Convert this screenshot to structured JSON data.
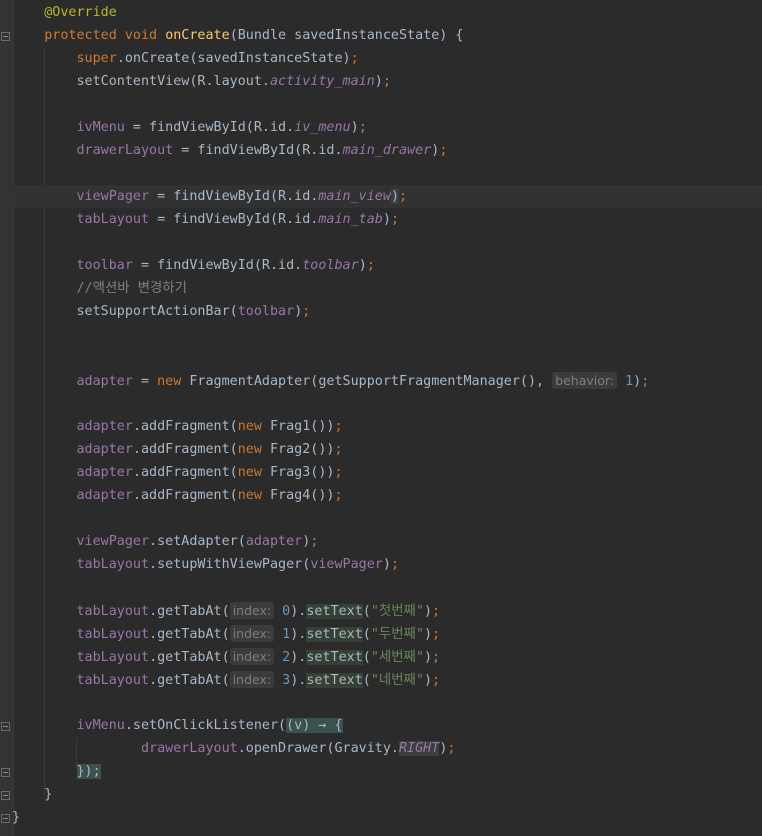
{
  "code": {
    "l1": {
      "annotation": "@Override"
    },
    "l2": {
      "kw": "protected void ",
      "fn": "onCreate",
      "rest": "(Bundle savedInstanceState) {"
    },
    "l3": {
      "kw": "super",
      "rest": ".onCreate(savedInstanceState)",
      "semi": ";"
    },
    "l4": {
      "pre": "setContentView(R.layout.",
      "field": "activity_main",
      "post": ")",
      "semi": ";"
    },
    "l5": {
      "var": "ivMenu",
      "pre": " = findViewById(R.id.",
      "field": "iv_menu",
      "post": ")",
      "semi": ";"
    },
    "l6": {
      "var": "drawerLayout",
      "pre": " = findViewById(R.id.",
      "field": "main_drawer",
      "post": ")",
      "semi": ";"
    },
    "l7": {
      "var": "viewPager",
      "pre": " = findViewById(R.id.",
      "field": "main_view",
      "post": ")",
      "semi": ";"
    },
    "l8": {
      "var": "tabLayout",
      "pre": " = findViewById(R.id.",
      "field": "main_tab",
      "post": ")",
      "semi": ";"
    },
    "l9": {
      "var": "toolbar",
      "pre": " = findViewById(R.id.",
      "field": "toolbar",
      "post": ")",
      "semi": ";"
    },
    "l10": {
      "comment": "//액션바 변경하기"
    },
    "l11": {
      "pre": "setSupportActionBar(",
      "var": "toolbar",
      "post": ")",
      "semi": ";"
    },
    "l12": {
      "var": "adapter",
      "eq": " = ",
      "kw": "new ",
      "pre": "FragmentAdapter(getSupportFragmentManager(),",
      "hint": "behavior:",
      "num": "1",
      "post": ")",
      "semi": ";"
    },
    "frags": [
      {
        "var": "adapter",
        "pre": ".addFragment(",
        "kw": "new ",
        "post": "Frag1())",
        "semi": ";"
      },
      {
        "var": "adapter",
        "pre": ".addFragment(",
        "kw": "new ",
        "post": "Frag2())",
        "semi": ";"
      },
      {
        "var": "adapter",
        "pre": ".addFragment(",
        "kw": "new ",
        "post": "Frag3())",
        "semi": ";"
      },
      {
        "var": "adapter",
        "pre": ".addFragment(",
        "kw": "new ",
        "post": "Frag4())",
        "semi": ";"
      }
    ],
    "l17": {
      "var": "viewPager",
      "pre": ".setAdapter(",
      "var2": "adapter",
      "post": ")",
      "semi": ";"
    },
    "l18": {
      "var": "tabLayout",
      "pre": ".setupWithViewPager(",
      "var2": "viewPager",
      "post": ")",
      "semi": ";"
    },
    "tabs": [
      {
        "var": "tabLayout",
        "pre": ".getTabAt(",
        "hint": "index:",
        "num": "0",
        "mid": ").",
        "call": "setText",
        "str": "\"첫번째\"",
        "post": ")",
        "semi": ";"
      },
      {
        "var": "tabLayout",
        "pre": ".getTabAt(",
        "hint": "index:",
        "num": "1",
        "mid": ").",
        "call": "setText",
        "str": "\"두번째\"",
        "post": ")",
        "semi": ";"
      },
      {
        "var": "tabLayout",
        "pre": ".getTabAt(",
        "hint": "index:",
        "num": "2",
        "mid": ").",
        "call": "setText",
        "str": "\"세번째\"",
        "post": ")",
        "semi": ";"
      },
      {
        "var": "tabLayout",
        "pre": ".getTabAt(",
        "hint": "index:",
        "num": "3",
        "mid": ").",
        "call": "setText",
        "str": "\"네번째\"",
        "post": ")",
        "semi": ";"
      }
    ],
    "l23": {
      "var": "ivMenu",
      "pre": ".setOnClickListener(",
      "lambda": "(v) → {"
    },
    "l24": {
      "var": "drawerLayout",
      "pre": ".openDrawer(Gravity.",
      "field": "RIGHT",
      "post": ")",
      "semi": ";"
    },
    "l25": {
      "close": "});"
    },
    "l26": {
      "close": "}"
    },
    "l27": {
      "close": "}"
    }
  }
}
